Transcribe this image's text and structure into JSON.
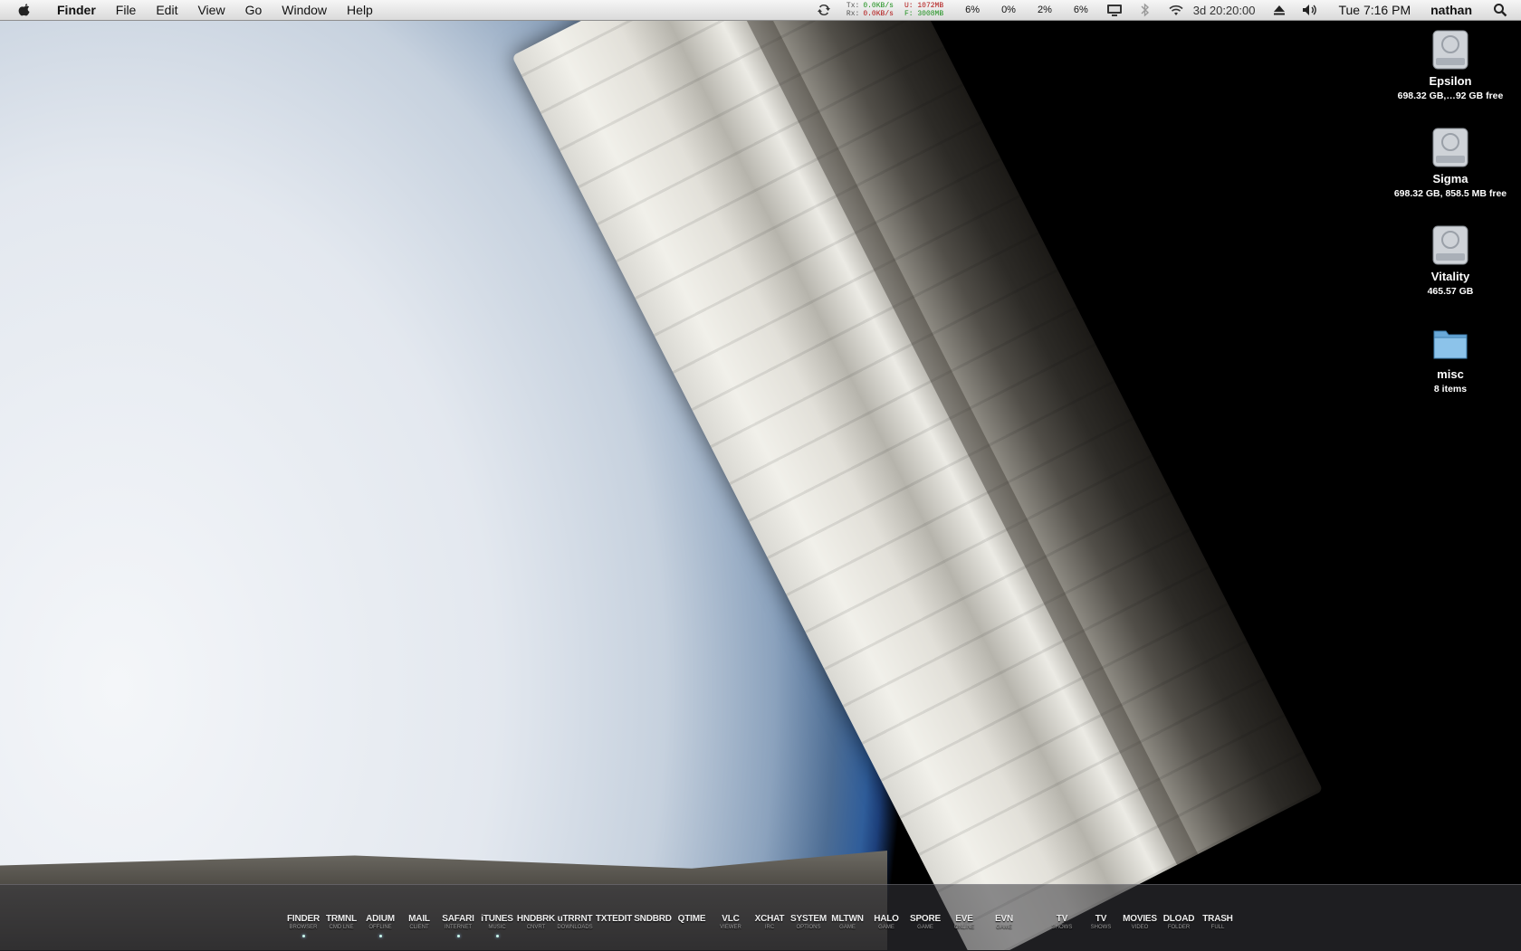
{
  "menubar": {
    "app_name": "Finder",
    "menus": [
      "File",
      "Edit",
      "View",
      "Go",
      "Window",
      "Help"
    ],
    "net": {
      "tx_label": "Tx:",
      "tx": "0.0KB/s",
      "rx_label": "Rx:",
      "rx": "0.0KB/s"
    },
    "mem": {
      "used": "U: 1072MB",
      "free": "F: 3008MB"
    },
    "cpu": [
      "6%",
      "0%",
      "2%",
      "6%"
    ],
    "uptime": "3d 20:20:00",
    "clock": "Tue 7:16 PM",
    "user": "nathan",
    "icons": [
      "apple-icon",
      "sync-icon",
      "display-icon",
      "bluetooth-icon",
      "wifi-icon",
      "eject-icon",
      "volume-icon",
      "spotlight-icon"
    ]
  },
  "desktop_icons": [
    {
      "name": "Epsilon",
      "sub": "698.32 GB,…92 GB free",
      "icon": "hard-drive-icon"
    },
    {
      "name": "Sigma",
      "sub": "698.32 GB, 858.5 MB free",
      "icon": "hard-drive-icon"
    },
    {
      "name": "Vitality",
      "sub": "465.57 GB",
      "icon": "hard-drive-icon"
    },
    {
      "name": "misc",
      "sub": "8 items",
      "icon": "folder-icon"
    }
  ],
  "dock": [
    {
      "label": "FINDER",
      "sub": "BROWSER",
      "running": true
    },
    {
      "label": "TRMNL",
      "sub": "CMD LNE",
      "running": false
    },
    {
      "label": "ADIUM",
      "sub": "OFFLINE",
      "running": true
    },
    {
      "label": "MAIL",
      "sub": "CLIENT",
      "running": false
    },
    {
      "label": "SAFARI",
      "sub": "INTERNET",
      "running": true
    },
    {
      "label": "iTUNES",
      "sub": "MUSIC",
      "running": true
    },
    {
      "label": "HNDBRK",
      "sub": "CNVRT",
      "running": false
    },
    {
      "label": "uTRRNT",
      "sub": "DOWNLOADS",
      "running": false
    },
    {
      "label": "TXTEDIT",
      "sub": "",
      "running": false
    },
    {
      "label": "SNDBRD",
      "sub": "",
      "running": false
    },
    {
      "label": "QTIME",
      "sub": "",
      "running": false
    },
    {
      "label": "VLC",
      "sub": "VIEWER",
      "running": false
    },
    {
      "label": "XCHAT",
      "sub": "IRC",
      "running": false
    },
    {
      "label": "SYSTEM",
      "sub": "OPTIONS",
      "running": false
    },
    {
      "label": "MLTWN",
      "sub": "GAME",
      "running": false
    },
    {
      "label": "HALO",
      "sub": "GAME",
      "running": false
    },
    {
      "label": "SPORE",
      "sub": "GAME",
      "running": false
    },
    {
      "label": "EVE",
      "sub": "ONLINE",
      "running": false
    },
    {
      "label": "EVN",
      "sub": "GAME",
      "running": false
    },
    {
      "label": "TV",
      "sub": "SHOWS",
      "running": false
    },
    {
      "label": "TV",
      "sub": "SHOWS",
      "running": false
    },
    {
      "label": "MOVIES",
      "sub": "VIDEO",
      "running": false
    },
    {
      "label": "DLOAD",
      "sub": "FOLDER",
      "running": false
    },
    {
      "label": "TRASH",
      "sub": "FULL",
      "running": false
    }
  ]
}
